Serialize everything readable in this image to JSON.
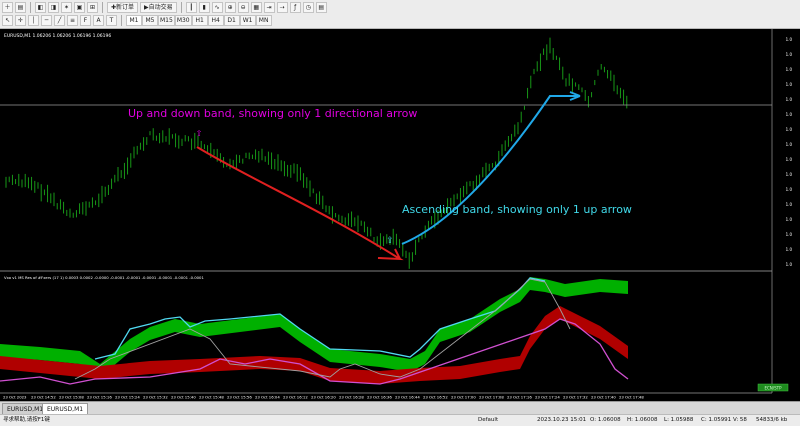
{
  "toolbar": {
    "new_order": "新订单",
    "autotrade": "自动交易",
    "timeframes": [
      "M1",
      "M5",
      "M15",
      "M30",
      "H1",
      "H4",
      "D1",
      "W1",
      "MN"
    ]
  },
  "chart": {
    "title": "EURUSD,M1  1.06206 1.06206 1.06196 1.06196",
    "indicator_title": "Vxo v1 MS Res of #Fxers (17 1) 0.0003 0.0002 -0.0000 -0.0001 -0.0001 -0.0001 -0.0001 -0.0001 -0.0001",
    "annotation_down": "Up and down band, showing only 1 directional arrow",
    "annotation_up": "Ascending band, showing only 1 up arrow",
    "annotation_down_color": "#e000e0",
    "annotation_up_color": "#40d8e8",
    "down_arrow_color": "#e02020",
    "up_arrow_color": "#20a8e8",
    "candle_color": "#1aa81a",
    "band_green": "#00b000",
    "band_red": "#b00000",
    "line_cyan": "#50d8f0",
    "line_magenta": "#d050d0",
    "line_gray": "#a0a0a0",
    "badge_label": "ECN/STP",
    "price_labels": [
      "1.0",
      "1.0",
      "1.0",
      "1.0",
      "1.0",
      "1.0",
      "1.0",
      "1.0",
      "1.0",
      "1.0",
      "1.0",
      "1.0",
      "1.0",
      "1.0",
      "1.0",
      "1.0"
    ],
    "time_labels": [
      "23 Oct 2023",
      "23 Oct 14:52",
      "23 Oct 15:08",
      "23 Oct 15:16",
      "23 Oct 15:24",
      "23 Oct 15:32",
      "23 Oct 15:40",
      "23 Oct 15:48",
      "23 Oct 15:56",
      "23 Oct 16:04",
      "23 Oct 16:12",
      "23 Oct 16:20",
      "23 Oct 16:28",
      "23 Oct 16:36",
      "23 Oct 16:44",
      "23 Oct 16:52",
      "23 Oct 17:00",
      "23 Oct 17:08",
      "23 Oct 17:16",
      "23 Oct 17:24",
      "23 Oct 17:32",
      "23 Oct 17:40",
      "23 Oct 17:48"
    ]
  },
  "tabs": [
    "EURUSD,M1",
    "EURUSD,M1"
  ],
  "status": {
    "help": "寻求帮助,请按F1键",
    "profile": "Default",
    "time": "2023.10.23 15:01",
    "open": "O: 1.06008",
    "high": "H: 1.06008",
    "low": "L: 1.05988",
    "close": "C: 1.05991",
    "volume": "V: 58",
    "traffic": "54833/6 kb"
  }
}
